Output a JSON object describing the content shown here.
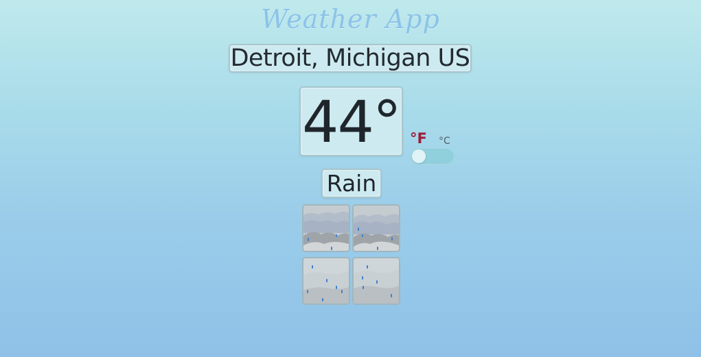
{
  "app": {
    "title": "Weather App"
  },
  "weather": {
    "location": "Detroit, Michigan US",
    "temperature": "44°",
    "condition": "Rain"
  },
  "units": {
    "fahrenheit_label": "°F",
    "celsius_label": "°C",
    "selected": "F"
  },
  "icons": [
    "cloudy-rain-icon",
    "cloudy-rain-icon",
    "rain-icon",
    "rain-icon"
  ],
  "colors": {
    "active_unit": "#9b1d3a",
    "toggle_track": "#90cfdc",
    "raindrop": "#3f7fcf"
  }
}
